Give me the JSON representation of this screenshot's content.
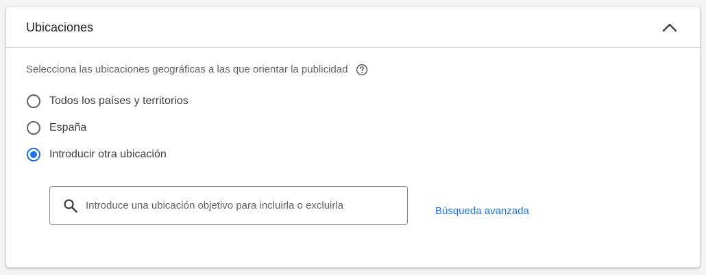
{
  "section": {
    "title": "Ubicaciones",
    "collapse_icon": "chevron-up-icon"
  },
  "description": {
    "text": "Selecciona las ubicaciones geográficas a las que orientar la publicidad",
    "help_icon": "help-circle-icon"
  },
  "location_options": [
    {
      "label": "Todos los países y territorios",
      "checked": false
    },
    {
      "label": "España",
      "checked": false
    },
    {
      "label": "Introducir otra ubicación",
      "checked": true
    }
  ],
  "search": {
    "icon": "search-icon",
    "value": "",
    "placeholder": "Introduce una ubicación objetivo para incluirla o excluirla"
  },
  "advanced_search_label": "Búsqueda avanzada",
  "colors": {
    "accent": "#1a73e8",
    "text_primary": "#202124",
    "text_secondary": "#5f6368",
    "divider": "#dadce0"
  }
}
